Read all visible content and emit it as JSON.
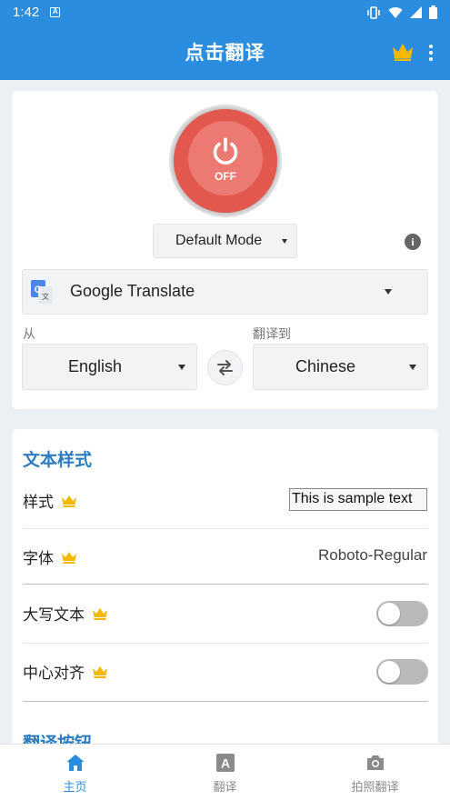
{
  "status_bar": {
    "time": "1:42",
    "notification_glyph": "A"
  },
  "app_bar": {
    "title": "点击翻译",
    "crown_icon": "crown-icon",
    "more_icon": "more-vert-icon"
  },
  "power": {
    "state_label": "OFF"
  },
  "mode_select": {
    "value": "Default Mode"
  },
  "engine_select": {
    "value": "Google Translate"
  },
  "languages": {
    "from_label": "从",
    "from_value": "English",
    "to_label": "翻译到",
    "to_value": "Chinese"
  },
  "text_style": {
    "section_title": "文本样式",
    "style_label": "样式",
    "style_sample": "This is sample text",
    "font_label": "字体",
    "font_value": "Roboto-Regular",
    "uppercase_label": "大写文本",
    "uppercase_on": false,
    "center_label": "中心对齐",
    "center_on": false
  },
  "next_section": {
    "title": "翻译按钮"
  },
  "bottom_nav": {
    "items": [
      {
        "label": "主页",
        "icon": "home-icon",
        "active": true
      },
      {
        "label": "翻译",
        "icon": "translate-icon",
        "active": false
      },
      {
        "label": "拍照翻译",
        "icon": "camera-icon",
        "active": false
      }
    ]
  },
  "colors": {
    "primary": "#2b8de0",
    "power_red": "#e2574e",
    "section_title": "#2c7bbd",
    "crown": "#f5b800"
  }
}
